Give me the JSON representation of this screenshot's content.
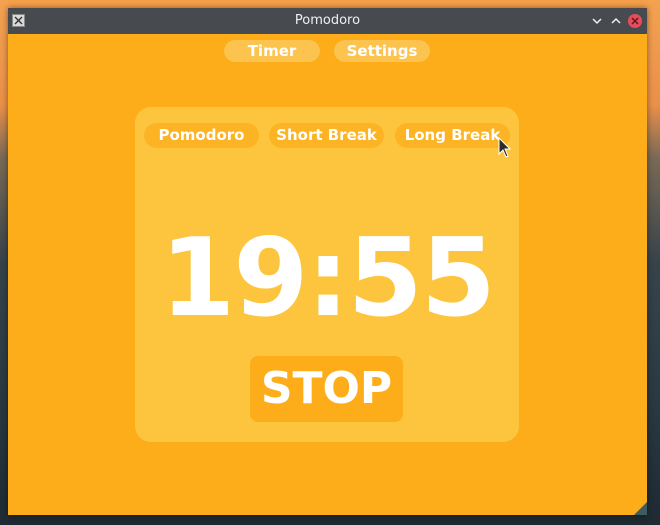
{
  "window": {
    "title": "Pomodoro"
  },
  "nav": {
    "tabs": [
      {
        "label": "Timer"
      },
      {
        "label": "Settings"
      }
    ]
  },
  "modes": [
    {
      "label": "Pomodoro"
    },
    {
      "label": "Short Break"
    },
    {
      "label": "Long Break"
    }
  ],
  "timer": {
    "display": "19:55",
    "action_label": "STOP"
  },
  "colors": {
    "background": "#fcad19",
    "card": "#fdc53d",
    "button": "#fcb324",
    "tab": "#fcc34e",
    "titlebar": "#474b50",
    "text": "#ffffff"
  },
  "icons": {
    "app": "app-icon",
    "minimize": "chevron-down-icon",
    "maximize": "chevron-up-icon",
    "close": "close-icon",
    "resize": "resize-grip-icon",
    "pointer": "mouse-cursor-icon"
  }
}
